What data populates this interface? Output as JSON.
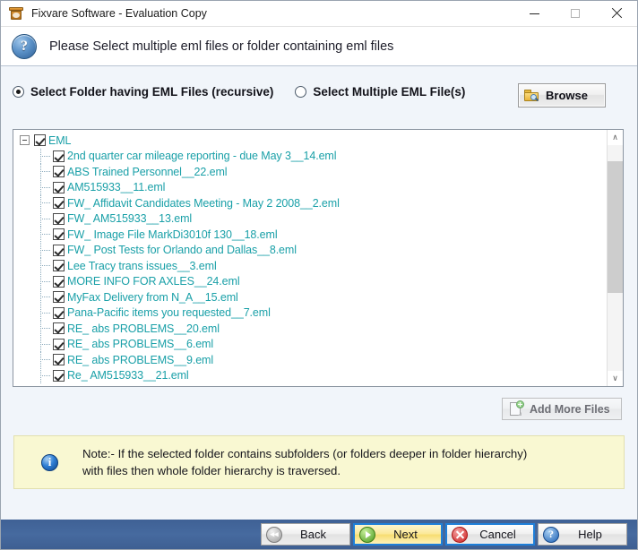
{
  "window": {
    "title": "Fixvare Software - Evaluation Copy",
    "app_icon": "software-box-icon",
    "controls": {
      "minimize": "minimize-icon",
      "maximize": "maximize-icon",
      "close": "close-icon"
    }
  },
  "header": {
    "icon": "help-question-icon",
    "icon_glyph": "?",
    "instruction": "Please Select multiple eml files or folder containing eml files"
  },
  "mode": {
    "options": [
      {
        "label": "Select Folder having EML Files (recursive)",
        "selected": true
      },
      {
        "label": "Select Multiple EML File(s)",
        "selected": false
      }
    ],
    "browse": {
      "label": "Browse",
      "icon": "folder-search-icon"
    }
  },
  "tree": {
    "root": {
      "label": "EML",
      "checked": true,
      "expanded": true,
      "expander_glyph": "-"
    },
    "items": [
      {
        "label": "2nd quarter car mileage reporting - due May 3__14.eml",
        "checked": true
      },
      {
        "label": "ABS Trained Personnel__22.eml",
        "checked": true
      },
      {
        "label": "AM515933__11.eml",
        "checked": true
      },
      {
        "label": "FW_ Affidavit Candidates Meeting - May 2 2008__2.eml",
        "checked": true
      },
      {
        "label": "FW_ AM515933__13.eml",
        "checked": true
      },
      {
        "label": "FW_ Image File MarkDi3010f 130__18.eml",
        "checked": true
      },
      {
        "label": "FW_ Post Tests for Orlando and Dallas__8.eml",
        "checked": true
      },
      {
        "label": "Lee Tracy trans issues__3.eml",
        "checked": true
      },
      {
        "label": "MORE INFO FOR AXLES__24.eml",
        "checked": true
      },
      {
        "label": "MyFax Delivery from N_A__15.eml",
        "checked": true
      },
      {
        "label": "Pana-Pacific items you requested__7.eml",
        "checked": true
      },
      {
        "label": "RE_ abs PROBLEMS__20.eml",
        "checked": true
      },
      {
        "label": "RE_ abs PROBLEMS__6.eml",
        "checked": true
      },
      {
        "label": "RE_ abs PROBLEMS__9.eml",
        "checked": true
      },
      {
        "label": "Re_ AM515933__21.eml",
        "checked": true
      }
    ],
    "scrollbar": {
      "up_glyph": "∧",
      "down_glyph": "∨"
    },
    "text_color": "#1aa0a8"
  },
  "add_more": {
    "label": "Add More Files",
    "icon": "document-add-icon",
    "enabled": false
  },
  "note": {
    "icon": "info-icon",
    "icon_glyph": "i",
    "text": "Note:- If the selected folder contains subfolders (or folders deeper in folder hierarchy)\n with files then whole folder hierarchy is traversed."
  },
  "footer": {
    "buttons": [
      {
        "label": "Back",
        "icon": "rewind-icon",
        "state": "normal"
      },
      {
        "label": "Next",
        "icon": "play-icon",
        "state": "default-focused"
      },
      {
        "label": "Cancel",
        "icon": "cancel-icon",
        "state": "focus-ring"
      },
      {
        "label": "Help",
        "icon": "help-icon",
        "state": "normal"
      }
    ]
  },
  "colors": {
    "accent_blue": "#1f7fd8",
    "footer_blue": "#466a9f",
    "note_yellow": "#f9f8d2",
    "tree_teal": "#1aa0a8",
    "next_amber": "#f7dd72"
  }
}
